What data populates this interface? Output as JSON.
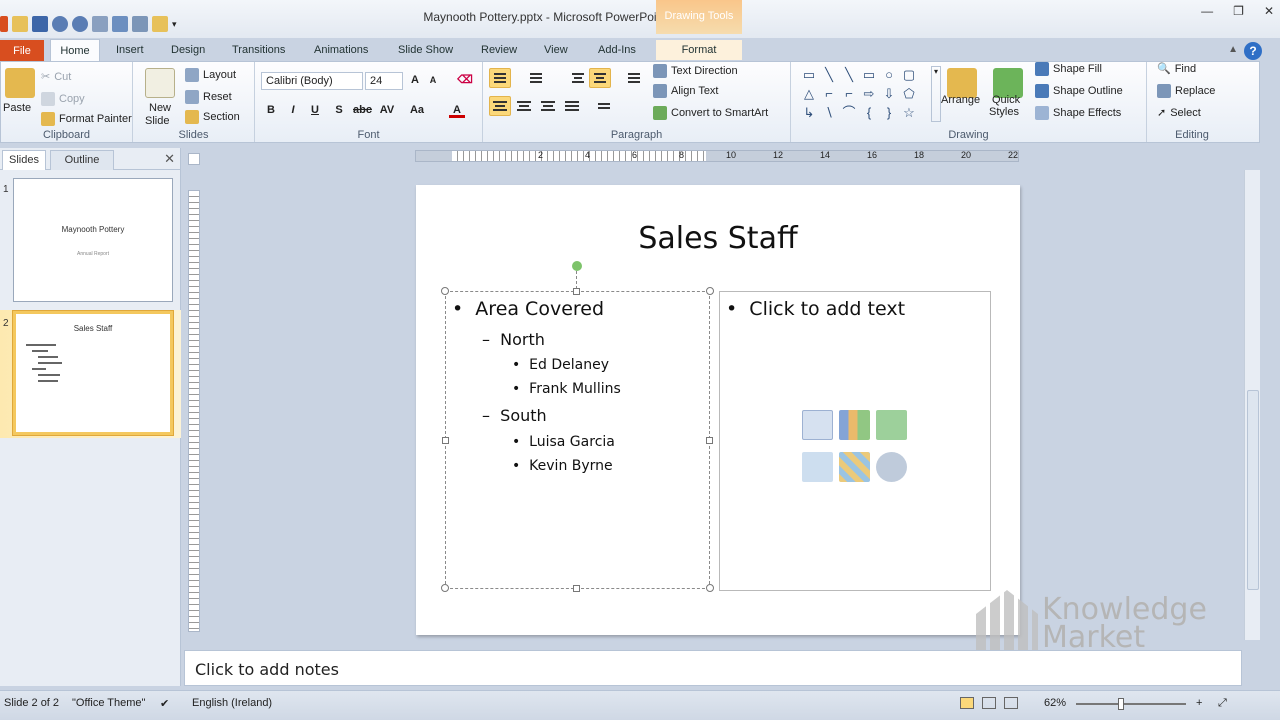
{
  "titlebar": {
    "title": "Maynooth Pottery.pptx - Microsoft PowerPoint",
    "context_tools": "Drawing Tools"
  },
  "tabs": [
    "File",
    "Home",
    "Insert",
    "Design",
    "Transitions",
    "Animations",
    "Slide Show",
    "Review",
    "View",
    "Add-Ins",
    "Format"
  ],
  "ribbon": {
    "clipboard": {
      "paste": "Paste",
      "cut": "Cut",
      "copy": "Copy",
      "format_painter": "Format Painter",
      "label": "Clipboard"
    },
    "slides": {
      "new_slide": "New",
      "new_slide_2": "Slide",
      "layout": "Layout",
      "reset": "Reset",
      "section": "Section",
      "label": "Slides"
    },
    "font": {
      "name": "Calibri (Body)",
      "size": "24",
      "label": "Font"
    },
    "paragraph": {
      "text_direction": "Text Direction",
      "align_text": "Align Text",
      "convert_smartart": "Convert to SmartArt",
      "label": "Paragraph"
    },
    "drawing": {
      "arrange": "Arrange",
      "quick_styles": "Quick",
      "quick_styles_2": "Styles",
      "shape_fill": "Shape Fill",
      "shape_outline": "Shape Outline",
      "shape_effects": "Shape Effects",
      "label": "Drawing"
    },
    "editing": {
      "find": "Find",
      "replace": "Replace",
      "select": "Select",
      "label": "Editing"
    }
  },
  "left_panel": {
    "tabs": [
      "Slides",
      "Outline"
    ],
    "thumbs": [
      {
        "number": "1",
        "title": "Maynooth Pottery",
        "subtitle": "Annual Report"
      },
      {
        "number": "2",
        "title": "Sales Staff"
      }
    ]
  },
  "ruler_h": [
    "2",
    "4",
    "6",
    "8",
    "10",
    "12",
    "14",
    "16",
    "18",
    "20",
    "22"
  ],
  "slide": {
    "title": "Sales Staff",
    "left_bullets": [
      {
        "level": 1,
        "text": "Area Covered"
      },
      {
        "level": 2,
        "text": "North"
      },
      {
        "level": 3,
        "text": "Ed Delaney"
      },
      {
        "level": 3,
        "text": "Frank Mullins"
      },
      {
        "level": 2,
        "text": "South"
      },
      {
        "level": 3,
        "text": "Luisa Garcia"
      },
      {
        "level": 3,
        "text": "Kevin Byrne"
      }
    ],
    "right_placeholder": "Click to add text"
  },
  "notes": {
    "placeholder": "Click to add notes"
  },
  "watermark": {
    "line1": "Knowledge",
    "line2": "Market"
  },
  "status": {
    "slide": "Slide 2 of 2",
    "theme": "\"Office Theme\"",
    "language": "English (Ireland)",
    "zoom": "62%"
  },
  "colors": {
    "file_tab": "#d84e1f",
    "context_tab": "#f6c27a",
    "selected_thumb": "#f4c85e"
  }
}
